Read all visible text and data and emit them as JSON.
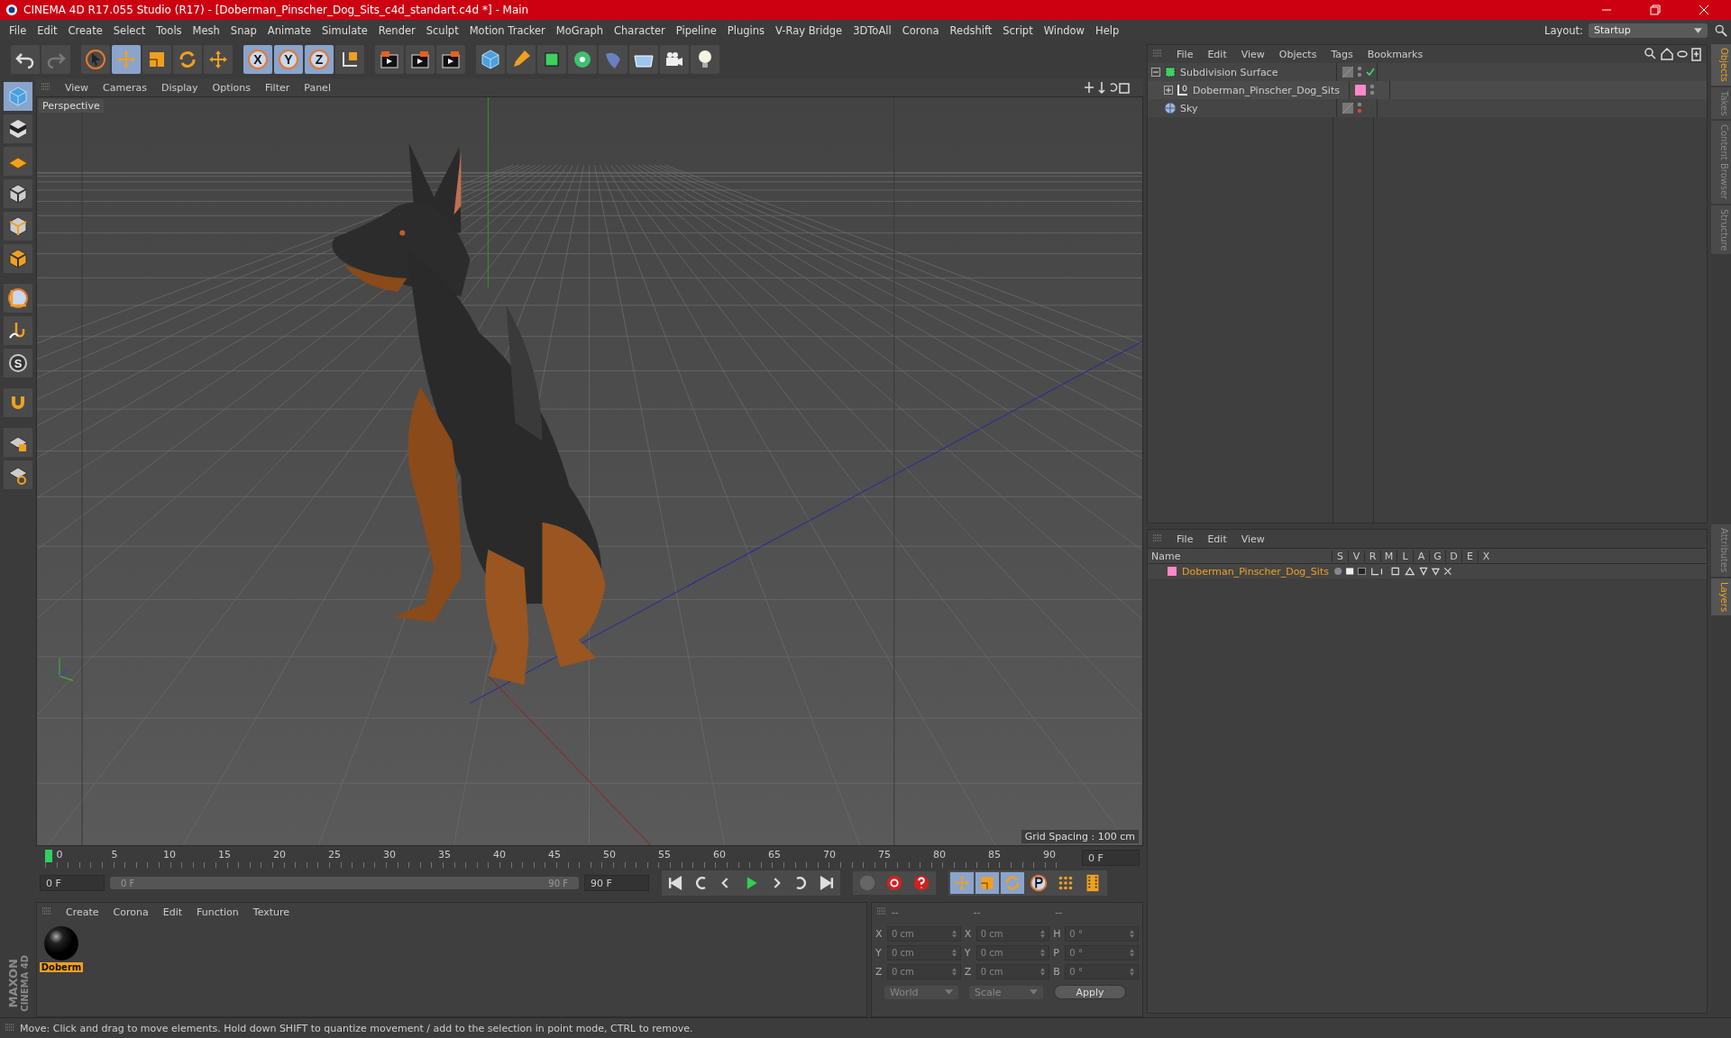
{
  "window": {
    "title": "CINEMA 4D R17.055 Studio (R17) - [Doberman_Pinscher_Dog_Sits_c4d_standart.c4d *] - Main"
  },
  "menu": [
    "File",
    "Edit",
    "Create",
    "Select",
    "Tools",
    "Mesh",
    "Snap",
    "Animate",
    "Simulate",
    "Render",
    "Sculpt",
    "Motion Tracker",
    "MoGraph",
    "Character",
    "Pipeline",
    "Plugins",
    "V-Ray Bridge",
    "3DToAll",
    "Corona",
    "Redshift",
    "Script",
    "Window",
    "Help"
  ],
  "layout": {
    "label": "Layout:",
    "value": "Startup"
  },
  "toolbar": [
    {
      "kind": "undo",
      "selected": false
    },
    {
      "kind": "redo",
      "selected": false
    },
    {
      "kind": "select",
      "selected": false
    },
    {
      "kind": "move",
      "selected": true
    },
    {
      "kind": "scale",
      "selected": false
    },
    {
      "kind": "rotate",
      "selected": false
    },
    {
      "kind": "transform",
      "selected": false
    },
    {
      "kind": "axis",
      "label": "X",
      "selected": true
    },
    {
      "kind": "axis",
      "label": "Y",
      "selected": true
    },
    {
      "kind": "axis",
      "label": "Z",
      "selected": true
    },
    {
      "kind": "coords",
      "selected": false
    },
    {
      "kind": "render-view",
      "selected": false
    },
    {
      "kind": "render-picture",
      "selected": false
    },
    {
      "kind": "render-settings",
      "selected": false
    },
    {
      "kind": "cube",
      "selected": false
    },
    {
      "kind": "pen",
      "selected": false
    },
    {
      "kind": "subdivision",
      "selected": false
    },
    {
      "kind": "cloner",
      "selected": false
    },
    {
      "kind": "deformer",
      "selected": false
    },
    {
      "kind": "floor",
      "selected": false
    },
    {
      "kind": "camera",
      "selected": false
    },
    {
      "kind": "light",
      "selected": false
    }
  ],
  "left_tools": [
    {
      "kind": "cube",
      "selected": true
    },
    {
      "kind": "checker",
      "selected": false
    },
    {
      "kind": "grid",
      "selected": false
    },
    {
      "kind": "points",
      "selected": false
    },
    {
      "kind": "edges",
      "selected": false
    },
    {
      "kind": "polygons",
      "selected": false
    },
    {
      "kind": "axis",
      "selected": false
    },
    {
      "kind": "brush",
      "selected": false
    },
    {
      "kind": "snap",
      "label": "S",
      "selected": false
    },
    {
      "kind": "magnet",
      "selected": false
    },
    {
      "kind": "lock",
      "selected": false
    },
    {
      "kind": "workplane",
      "selected": false
    }
  ],
  "viewport": {
    "menu": [
      "View",
      "Cameras",
      "Display",
      "Options",
      "Filter",
      "Panel"
    ],
    "camera": "Perspective",
    "grid_spacing": "Grid Spacing : 100 cm"
  },
  "timeline": {
    "level": 1,
    "ticks": [
      "0",
      "5",
      "10",
      "15",
      "20",
      "25",
      "30",
      "35",
      "40",
      "45",
      "50",
      "55",
      "60",
      "65",
      "70",
      "75",
      "80",
      "85",
      "90"
    ],
    "current_frame": "0 F",
    "start": "0 F",
    "range_start": "0 F",
    "range_end": "90 F",
    "end": "90 F"
  },
  "materials": {
    "menu": [
      "Create",
      "Corona",
      "Edit",
      "Function",
      "Texture"
    ],
    "items": [
      {
        "name": "Doberm",
        "selected": true
      }
    ]
  },
  "coordinates": {
    "headers": [
      "--",
      "--",
      "--"
    ],
    "columns": [
      [
        {
          "axis": "X",
          "value": "0 cm"
        },
        {
          "axis": "Y",
          "value": "0 cm"
        },
        {
          "axis": "Z",
          "value": "0 cm"
        }
      ],
      [
        {
          "axis": "X",
          "value": "0 cm"
        },
        {
          "axis": "Y",
          "value": "0 cm"
        },
        {
          "axis": "Z",
          "value": "0 cm"
        }
      ],
      [
        {
          "axis": "H",
          "value": "0 °"
        },
        {
          "axis": "P",
          "value": "0 °"
        },
        {
          "axis": "B",
          "value": "0 °"
        }
      ]
    ],
    "mode": "World",
    "type": "Scale",
    "apply": "Apply"
  },
  "objects": {
    "menu": [
      "File",
      "Edit",
      "View",
      "Objects",
      "Tags",
      "Bookmarks"
    ],
    "items": [
      {
        "name": "Subdivision Surface",
        "kind": "subdivision",
        "expanded": true,
        "enabled": true,
        "render_off": false,
        "children": [
          {
            "name": "Doberman_Pinscher_Dog_Sits",
            "kind": "null",
            "expanded": false,
            "enabled": false,
            "render_off": false,
            "color": "#ff88c8"
          }
        ]
      },
      {
        "name": "Sky",
        "kind": "sky",
        "enabled": false,
        "render_off": true
      }
    ]
  },
  "layers": {
    "menu": [
      "File",
      "Edit",
      "View"
    ],
    "name_header": "Name",
    "columns": [
      "S",
      "V",
      "R",
      "M",
      "L",
      "A",
      "G",
      "D",
      "E",
      "X"
    ],
    "items": [
      {
        "name": "Doberman_Pinscher_Dog_Sits",
        "color": "#ff88c8"
      }
    ]
  },
  "side_tabs_top": [
    {
      "label": "Objects",
      "selected": true
    },
    {
      "label": "Takes",
      "selected": false
    },
    {
      "label": "Content Browser",
      "selected": false
    },
    {
      "label": "Structure",
      "selected": false
    }
  ],
  "side_tabs_bottom": [
    {
      "label": "Attributes",
      "selected": false
    },
    {
      "label": "Layers",
      "selected": true
    }
  ],
  "logo": {
    "brand": "MAXON",
    "product": "CINEMA 4D"
  },
  "status_bar": "Move: Click and drag to move elements. Hold down SHIFT to quantize movement / add to the selection in point mode, CTRL to remove."
}
